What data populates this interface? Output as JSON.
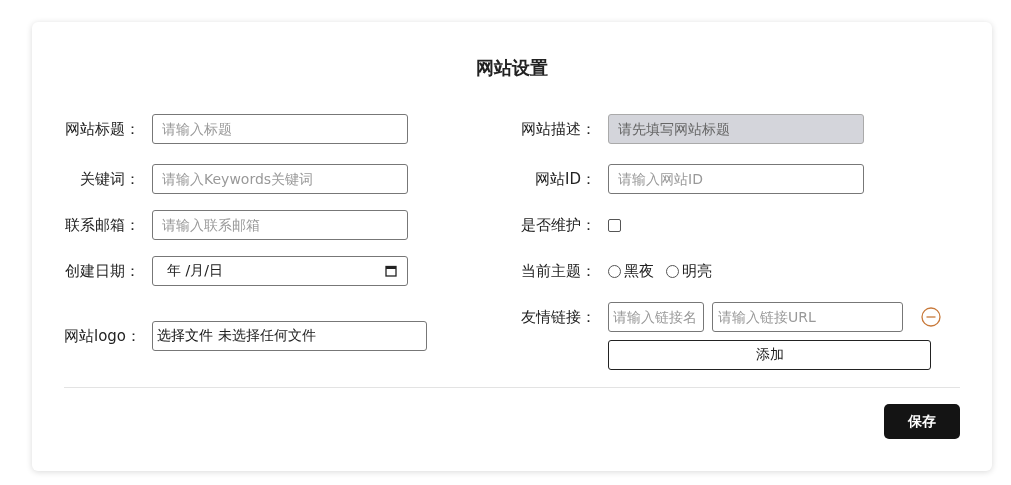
{
  "title": "网站设置",
  "left_fields": [
    {
      "kind": "text",
      "label": "网站标题：",
      "placeholder": "请输入标题",
      "disabled": false
    },
    {
      "kind": "text",
      "label": "关键词：",
      "placeholder": "请输入Keywords关键词",
      "disabled": false
    },
    {
      "kind": "text",
      "label": "联系邮箱：",
      "placeholder": "请输入联系邮箱",
      "disabled": false
    },
    {
      "kind": "date",
      "label": "创建日期：",
      "value": "年 /月/日"
    },
    {
      "kind": "file",
      "label": "网站logo：",
      "button": "选择文件",
      "value": "未选择任何文件"
    }
  ],
  "right_fields": [
    {
      "kind": "text",
      "label": "网站描述：",
      "placeholder": "请先填写网站标题",
      "disabled": true
    },
    {
      "kind": "text",
      "label": "网站ID：",
      "placeholder": "请输入网站ID",
      "disabled": false
    },
    {
      "kind": "checkbox",
      "label": "是否维护：",
      "checked": false
    },
    {
      "kind": "radio",
      "label": "当前主题：",
      "options": [
        {
          "label": "黑夜",
          "selected": false
        },
        {
          "label": "明亮",
          "selected": false
        }
      ]
    },
    {
      "kind": "links",
      "label": "友情链接：",
      "name_placeholder": "请输入链接名",
      "url_placeholder": "请输入链接URL",
      "add_button": "添加"
    }
  ],
  "save_button": "保存"
}
